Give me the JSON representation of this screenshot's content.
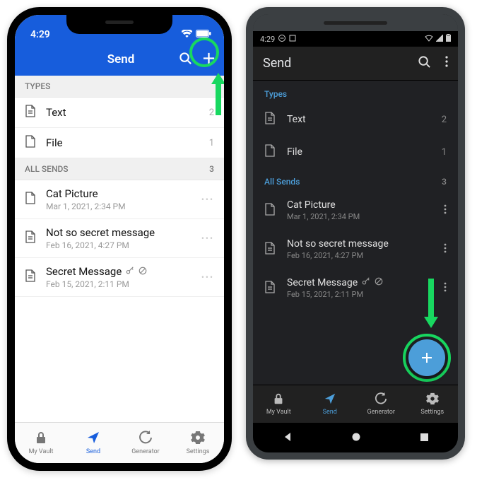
{
  "ios": {
    "status_time": "4:29",
    "header_title": "Send",
    "type_section_label": "TYPES",
    "types": [
      {
        "label": "Text",
        "count": "2"
      },
      {
        "label": "File",
        "count": "1"
      }
    ],
    "all_section_label": "ALL SENDS",
    "all_count": "3",
    "sends": [
      {
        "title": "Cat Picture",
        "date": "Mar 1, 2021, 2:34 PM",
        "icon": "file",
        "key": false,
        "disabled": false
      },
      {
        "title": "Not so secret message",
        "date": "Feb 16, 2021, 4:27 PM",
        "icon": "text",
        "key": false,
        "disabled": false
      },
      {
        "title": "Secret Message",
        "date": "Feb 15, 2021, 2:11 PM",
        "icon": "text",
        "key": true,
        "disabled": true
      }
    ],
    "tabs": [
      {
        "label": "My Vault"
      },
      {
        "label": "Send"
      },
      {
        "label": "Generator"
      },
      {
        "label": "Settings"
      }
    ]
  },
  "android": {
    "status_time": "4:29",
    "header_title": "Send",
    "type_section_label": "Types",
    "types": [
      {
        "label": "Text",
        "count": "2"
      },
      {
        "label": "File",
        "count": "1"
      }
    ],
    "all_section_label": "All Sends",
    "all_count": "3",
    "sends": [
      {
        "title": "Cat Picture",
        "date": "Mar 1, 2021, 2:34 PM",
        "icon": "file",
        "key": false,
        "disabled": false
      },
      {
        "title": "Not so secret message",
        "date": "Feb 16, 2021, 4:27 PM",
        "icon": "text",
        "key": false,
        "disabled": false
      },
      {
        "title": "Secret Message",
        "date": "Feb 15, 2021, 2:11 PM",
        "icon": "text",
        "key": true,
        "disabled": true
      }
    ],
    "tabs": [
      {
        "label": "My Vault"
      },
      {
        "label": "Send"
      },
      {
        "label": "Generator"
      },
      {
        "label": "Settings"
      }
    ]
  },
  "colors": {
    "ios_accent": "#175ddc",
    "android_accent": "#4c9ed9",
    "highlight_green": "#18d860"
  }
}
